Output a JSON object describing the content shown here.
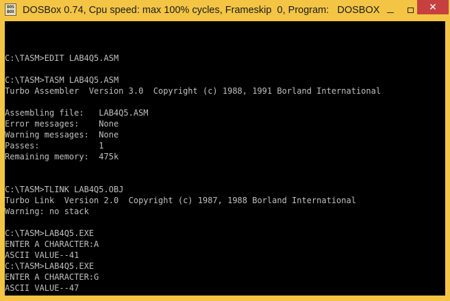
{
  "window": {
    "title": "DOSBox 0.74, Cpu speed: max 100% cycles, Frameskip  0, Program:   DOSBOX",
    "icon_text_line1": "DOS",
    "icon_text_line2": "BOX",
    "minimize_icon": "minimize-icon",
    "maximize_icon": "maximize-icon",
    "close_icon": "close-icon",
    "close_glyph": "✕",
    "frame_color": "#f4c545",
    "close_color": "#c74040"
  },
  "console": {
    "background": "#000000",
    "foreground": "#c0c0c0",
    "lines": [
      "",
      "C:\\TASM>EDIT LAB4Q5.ASM",
      "",
      "C:\\TASM>TASM LAB4Q5.ASM",
      "Turbo Assembler  Version 3.0  Copyright (c) 1988, 1991 Borland International",
      "",
      "Assembling file:   LAB4Q5.ASM",
      "Error messages:    None",
      "Warning messages:  None",
      "Passes:            1",
      "Remaining memory:  475k",
      "",
      "",
      "C:\\TASM>TLINK LAB4Q5.OBJ",
      "Turbo Link  Version 2.0  Copyright (c) 1987, 1988 Borland International",
      "Warning: no stack",
      "",
      "C:\\TASM>LAB4Q5.EXE",
      "ENTER A CHARACTER:A",
      "ASCII VALUE--41",
      "C:\\TASM>LAB4Q5.EXE",
      "ENTER A CHARACTER:G",
      "ASCII VALUE--47"
    ],
    "prompt": "C:\\TASM>"
  }
}
